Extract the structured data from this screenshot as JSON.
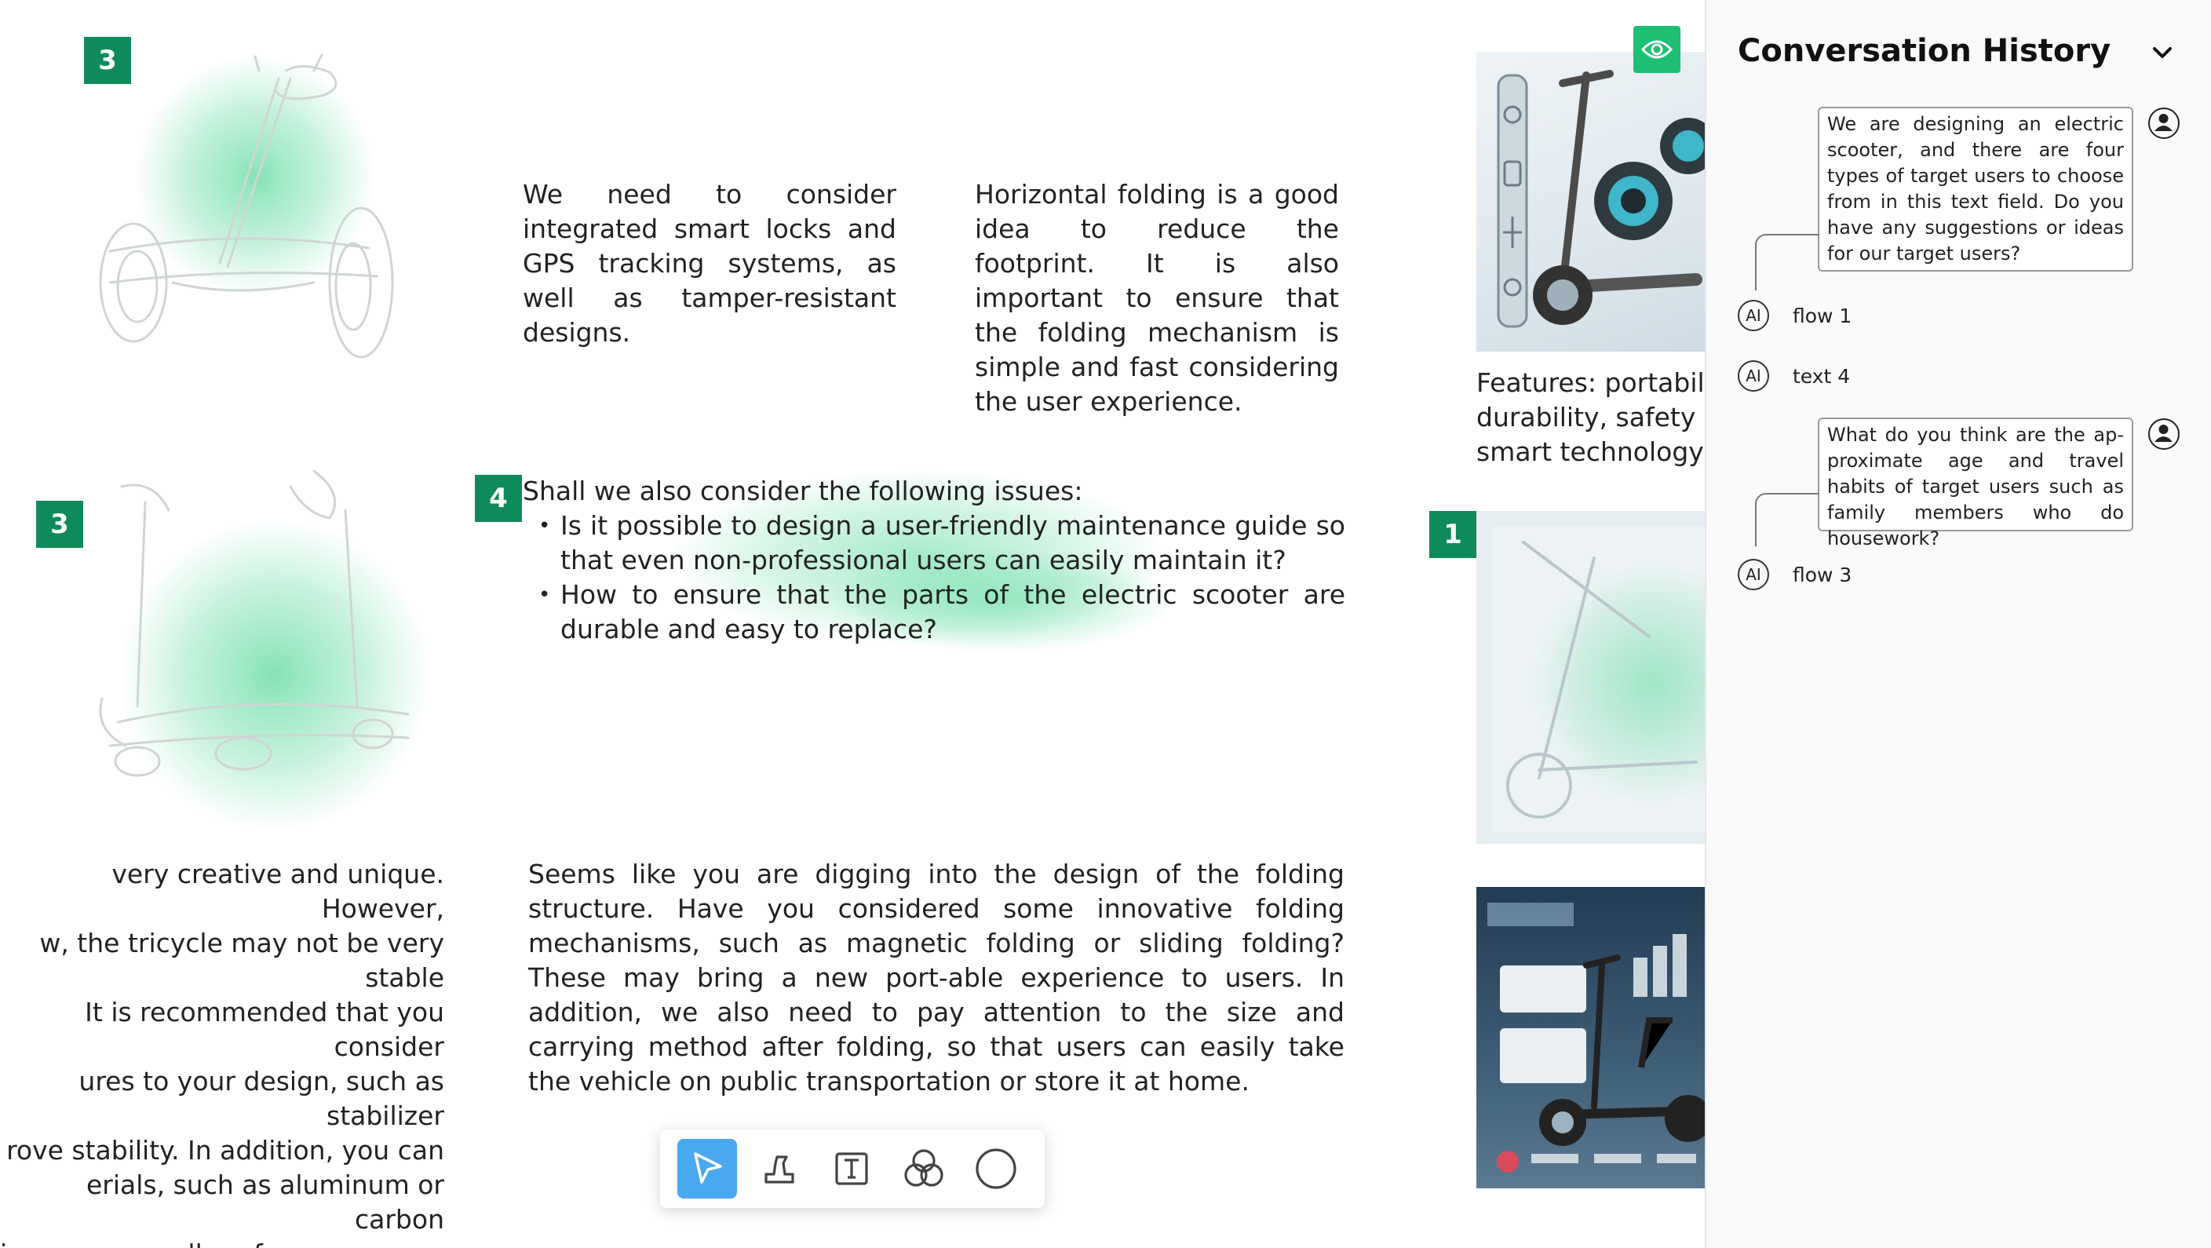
{
  "canvas": {
    "badges": [
      "3",
      "3",
      "4",
      "1"
    ],
    "text_blocks": {
      "security": "We need to consider integrated smart locks and GPS tracking systems, as well as tamper-resistant designs.",
      "folding": "Horizontal folding is a good idea to reduce the footprint. It is also important to ensure that the folding mechanism is simple and fast considering the user experience.",
      "features": [
        "Features: portabilit",
        "durability, safety ar",
        "smart technology"
      ],
      "tricycle": [
        "very creative and unique. However,",
        "w, the tricycle may not be very stable",
        "It is recommended that you consider",
        "ures to your design, such as stabilizer",
        "rove stability. In addition, you can",
        "erials, such as aluminum or carbon",
        "improve overall performance."
      ],
      "folding_structure": "Seems like you are digging into the design of the folding structure. Have you considered some innovative folding mechanisms, such as magnetic folding or sliding folding? These may bring a new port-able experience to users. In addition, we also need to pay attention to the size and carrying method after folding, so that users can easily take the vehicle on public transportation or store it at home."
    },
    "issues": {
      "heading": "Shall we also consider the following issues:",
      "items": [
        "Is it possible to design a user-friendly maintenance guide so that even non-professional users can easily maintain it?",
        "How to ensure that the parts of the electric scooter are durable and easy to replace?"
      ]
    }
  },
  "toolbar": {
    "tools": [
      {
        "name": "select",
        "icon": "cursor-arrow-icon",
        "active": true
      },
      {
        "name": "stamp",
        "icon": "stamp-icon",
        "active": false
      },
      {
        "name": "text",
        "icon": "text-box-icon",
        "active": false
      },
      {
        "name": "shapes",
        "icon": "overlap-circles-icon",
        "active": false
      },
      {
        "name": "circle",
        "icon": "circle-icon",
        "active": false
      }
    ],
    "active_color": "#4aa8f0"
  },
  "history": {
    "title": "Conversation History",
    "messages": [
      {
        "role": "user",
        "text": "We are designing an electric scooter, and there are four types of target users to choose from in this text field. Do you have any suggestions or ideas for our target users?"
      },
      {
        "role": "ai",
        "avatar": "AI",
        "label": "flow 1"
      },
      {
        "role": "ai",
        "avatar": "AI",
        "label": "text 4"
      },
      {
        "role": "user",
        "text": "What do you think are the ap-proximate age and travel habits of target users such as family members who do housework?"
      },
      {
        "role": "ai",
        "avatar": "AI",
        "label": "flow 3"
      }
    ]
  },
  "colors": {
    "badge": "#0f8a5b",
    "glow": "#5edaa0",
    "eye_button": "#1dbf73"
  }
}
